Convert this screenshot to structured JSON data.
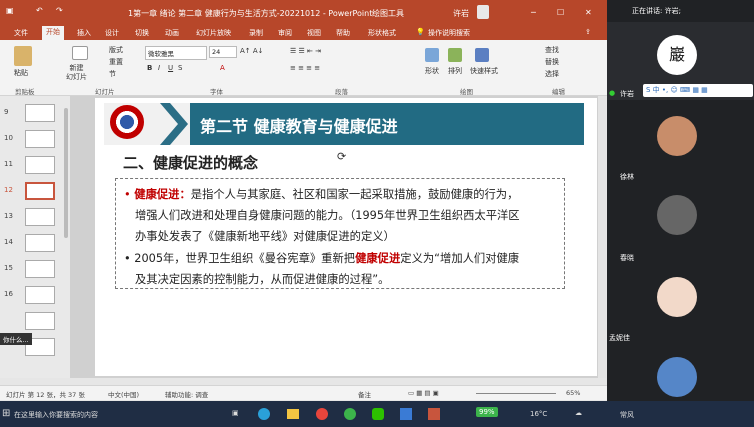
{
  "window": {
    "title": "1第一章 绪论 第二章 健康行为与生活方式-20221012 - PowerPoint",
    "tool_context": "绘图工具",
    "user": "许岩"
  },
  "tabs": [
    "文件",
    "开始",
    "插入",
    "设计",
    "切换",
    "动画",
    "幻灯片放映",
    "录制",
    "审阅",
    "视图",
    "帮助",
    "形状格式"
  ],
  "tell_me": "操作说明搜索",
  "ribbon": {
    "paste": "粘贴",
    "new_slide": "新建\n幻灯片",
    "layout": "版式",
    "reset": "重置",
    "section": "节",
    "font_name": "微软雅黑",
    "font_size": "24",
    "shape": "形状",
    "arrange": "排列",
    "quick_styles": "快速样式",
    "find": "查找",
    "replace": "替换",
    "select": "选择",
    "groups": {
      "clipboard": "剪贴板",
      "slides": "幻灯片",
      "font": "字体",
      "paragraph": "段落",
      "drawing": "绘图",
      "editing": "编辑"
    }
  },
  "thumbnails": [
    "9",
    "10",
    "11",
    "12",
    "13",
    "14",
    "15",
    "16"
  ],
  "selected_thumbnail": "12",
  "slide": {
    "title": "第二节  健康教育与健康促进",
    "subtitle": "二、健康促进的概念",
    "b1_bold": "健康促进：",
    "b1_rest": "是指个人与其家庭、社区和国家一起采取措施，鼓励健康的行为，",
    "b1_l2": "增强人们改进和处理自身健康问题的能力。（1995年世界卫生组织西太平洋区",
    "b1_l3": "办事处发表了《健康新地平线》对健康促进的定义）",
    "b2_a": "2005年，世界卫生组织《曼谷宪章》重新把",
    "b2_red": "健康促进",
    "b2_b": "定义为“增加人们对健康",
    "b2_l2": "及其决定因素的控制能力，从而促进健康的过程”。"
  },
  "status": {
    "slide_info": "幻灯片 第 12 张，共 37 张",
    "lang": "中文(中国)",
    "accessibility": "辅助功能: 调查",
    "notes": "备注",
    "zoom": "65%"
  },
  "left_tooltip": "你什么...",
  "taskbar": {
    "search": "在这里输入你要搜索的内容",
    "battery": "99%",
    "temp": "16°C",
    "weather_user": "常风"
  },
  "meeting": {
    "speaking": "正在讲话: 许岩;",
    "participants": [
      "许岩",
      "徐林",
      "春晓",
      "孟妮佳"
    ]
  }
}
